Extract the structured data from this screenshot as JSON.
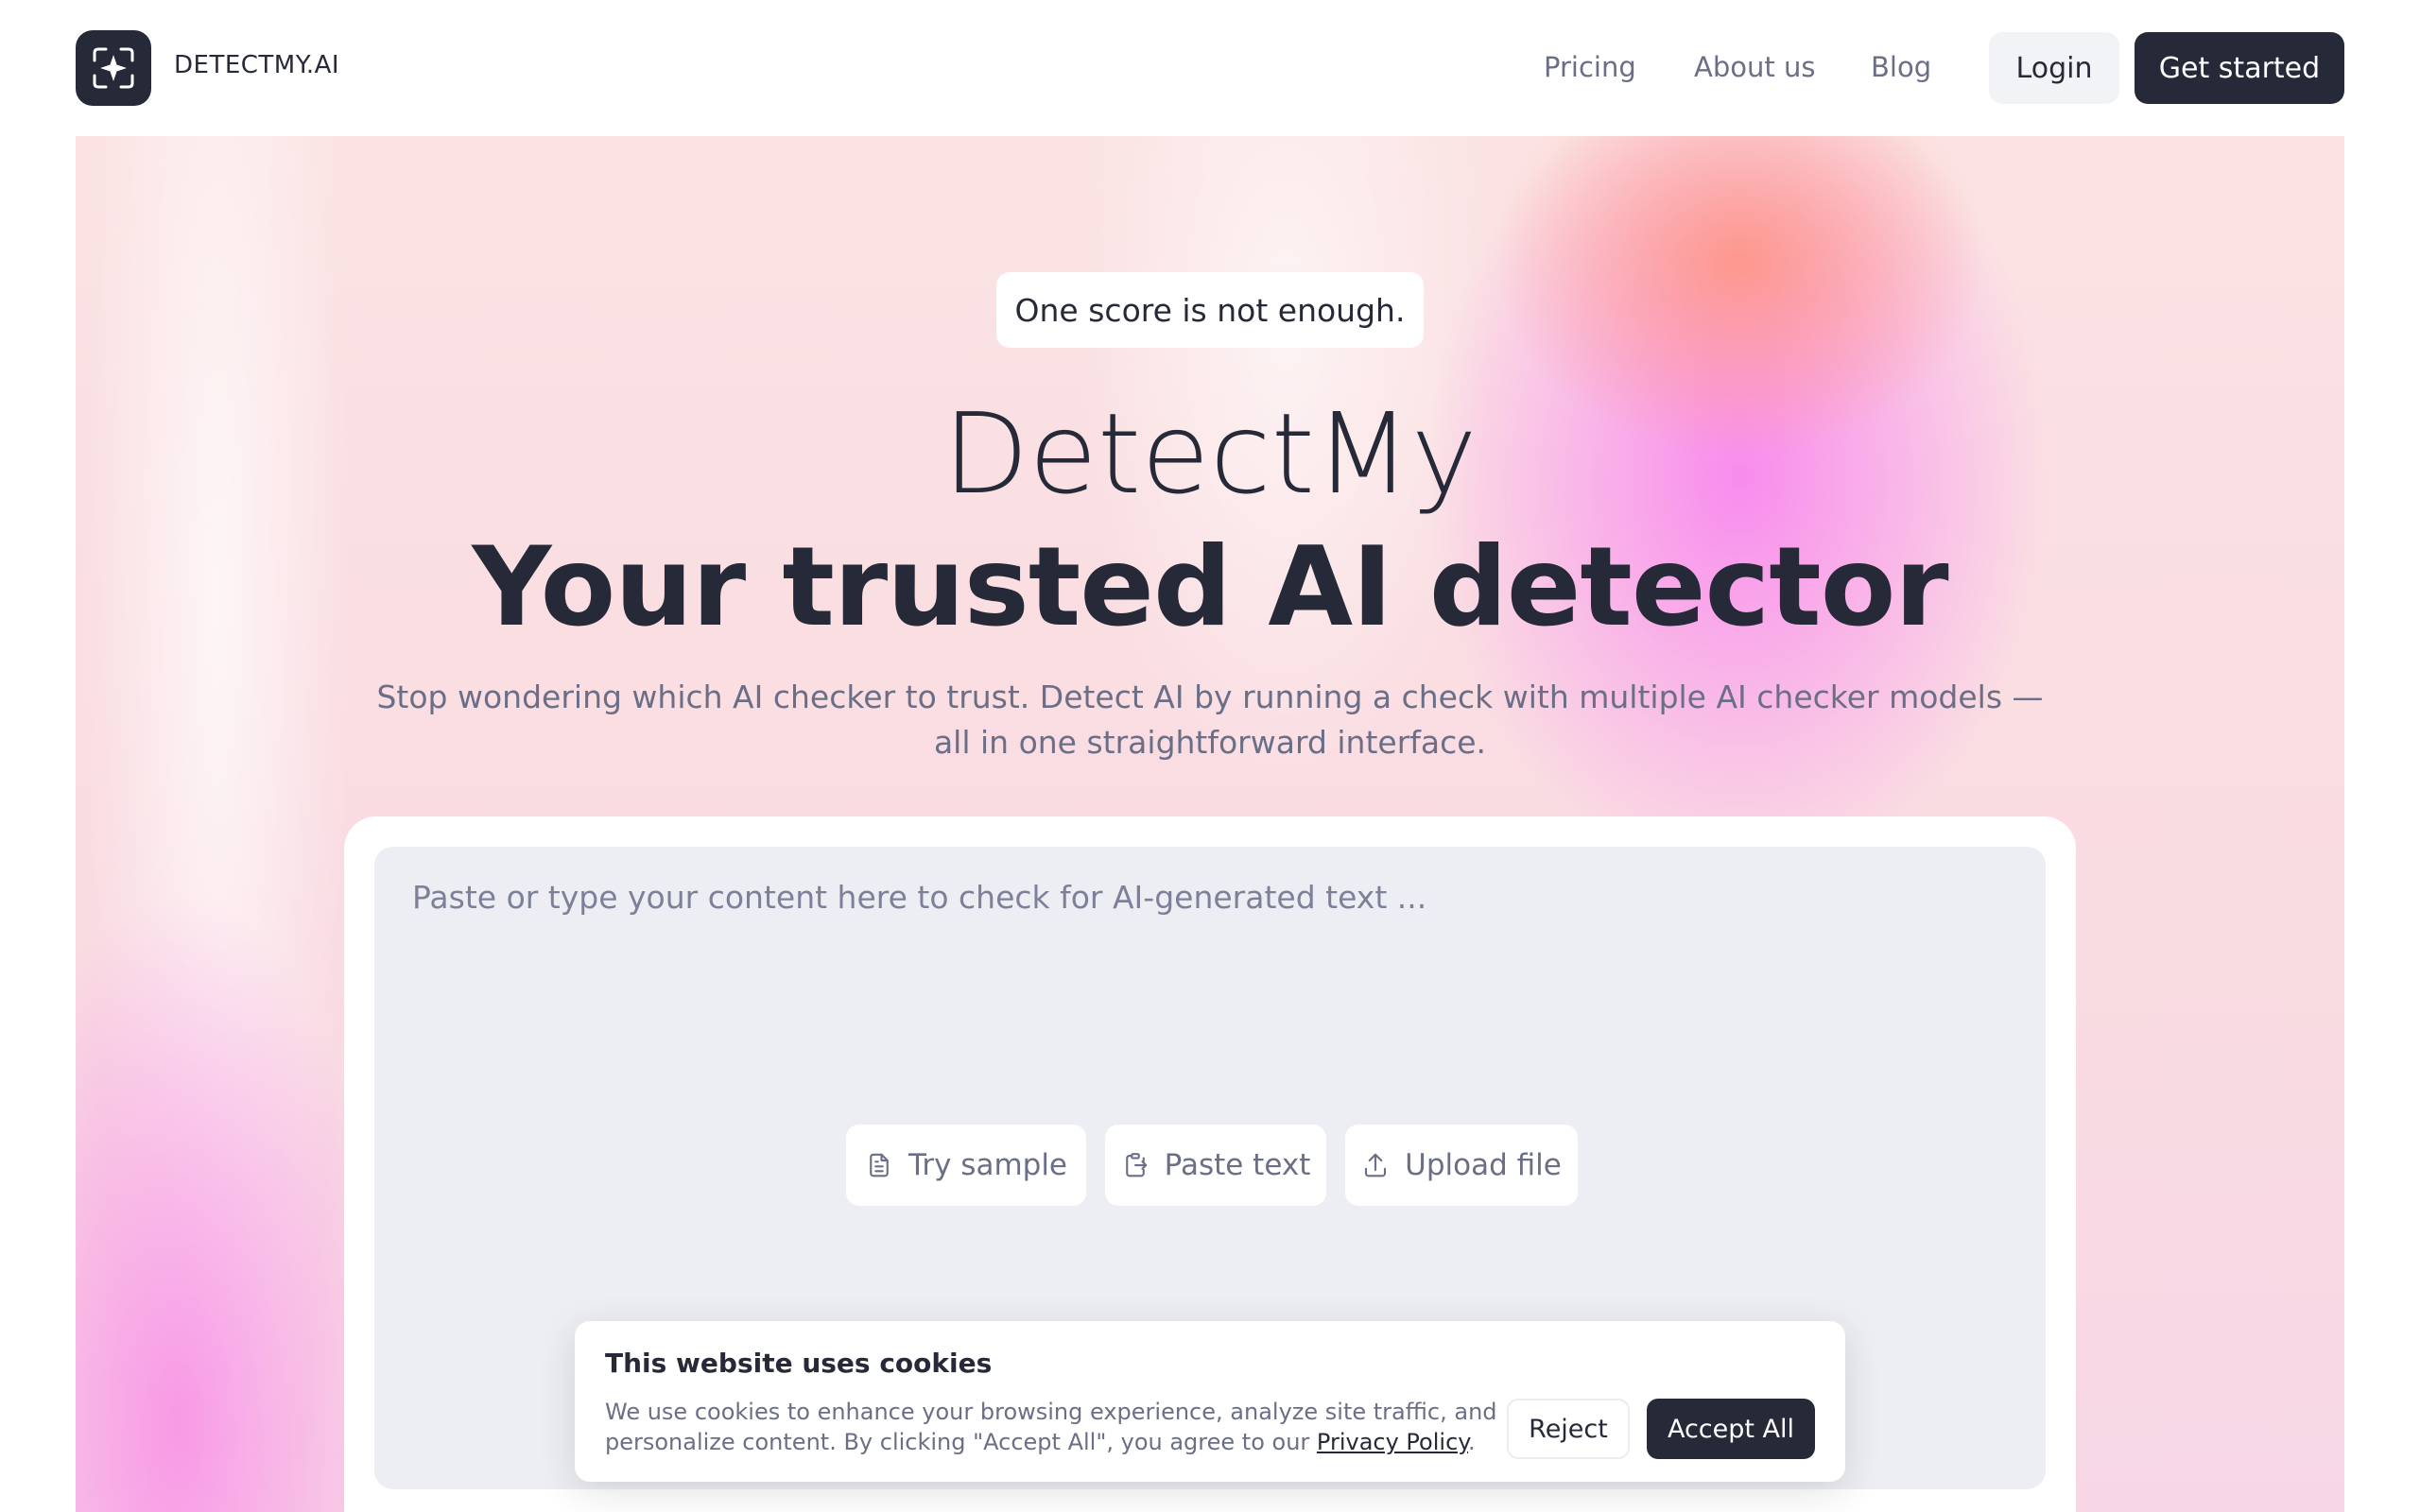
{
  "header": {
    "brand": "DETECTMY.AI",
    "logo_icon": "sparkle-frame-icon",
    "nav": {
      "pricing": "Pricing",
      "about": "About us",
      "blog": "Blog"
    },
    "login_label": "Login",
    "get_started_label": "Get started"
  },
  "hero": {
    "tagline": "One score is not enough.",
    "title_light": "DetectMy",
    "title_bold": "Your trusted AI detector",
    "subtitle": "Stop wondering which AI checker to trust. Detect AI by running a check with multiple AI checker models — all in one straightforward interface."
  },
  "detector": {
    "placeholder": "Paste or type your content here to check for AI-generated text ...",
    "actions": {
      "try_sample": "Try sample",
      "paste_text": "Paste text",
      "upload_file": "Upload file"
    },
    "icons": {
      "try_sample": "document-icon",
      "paste_text": "clipboard-icon",
      "upload_file": "upload-icon"
    }
  },
  "cookie_banner": {
    "title": "This website uses cookies",
    "text_before_link": "We use cookies to enhance your browsing experience, analyze site traffic, and personalize content. By clicking \"Accept All\", you agree to our ",
    "link_label": "Privacy Policy",
    "text_after_link": ".",
    "reject_label": "Reject",
    "accept_label": "Accept All"
  },
  "colors": {
    "primary_dark": "#262937",
    "muted_text": "#6a6f87",
    "input_bg": "#edeef3",
    "accent_pink": "#f878f0",
    "accent_orange": "#ff8c6e"
  }
}
